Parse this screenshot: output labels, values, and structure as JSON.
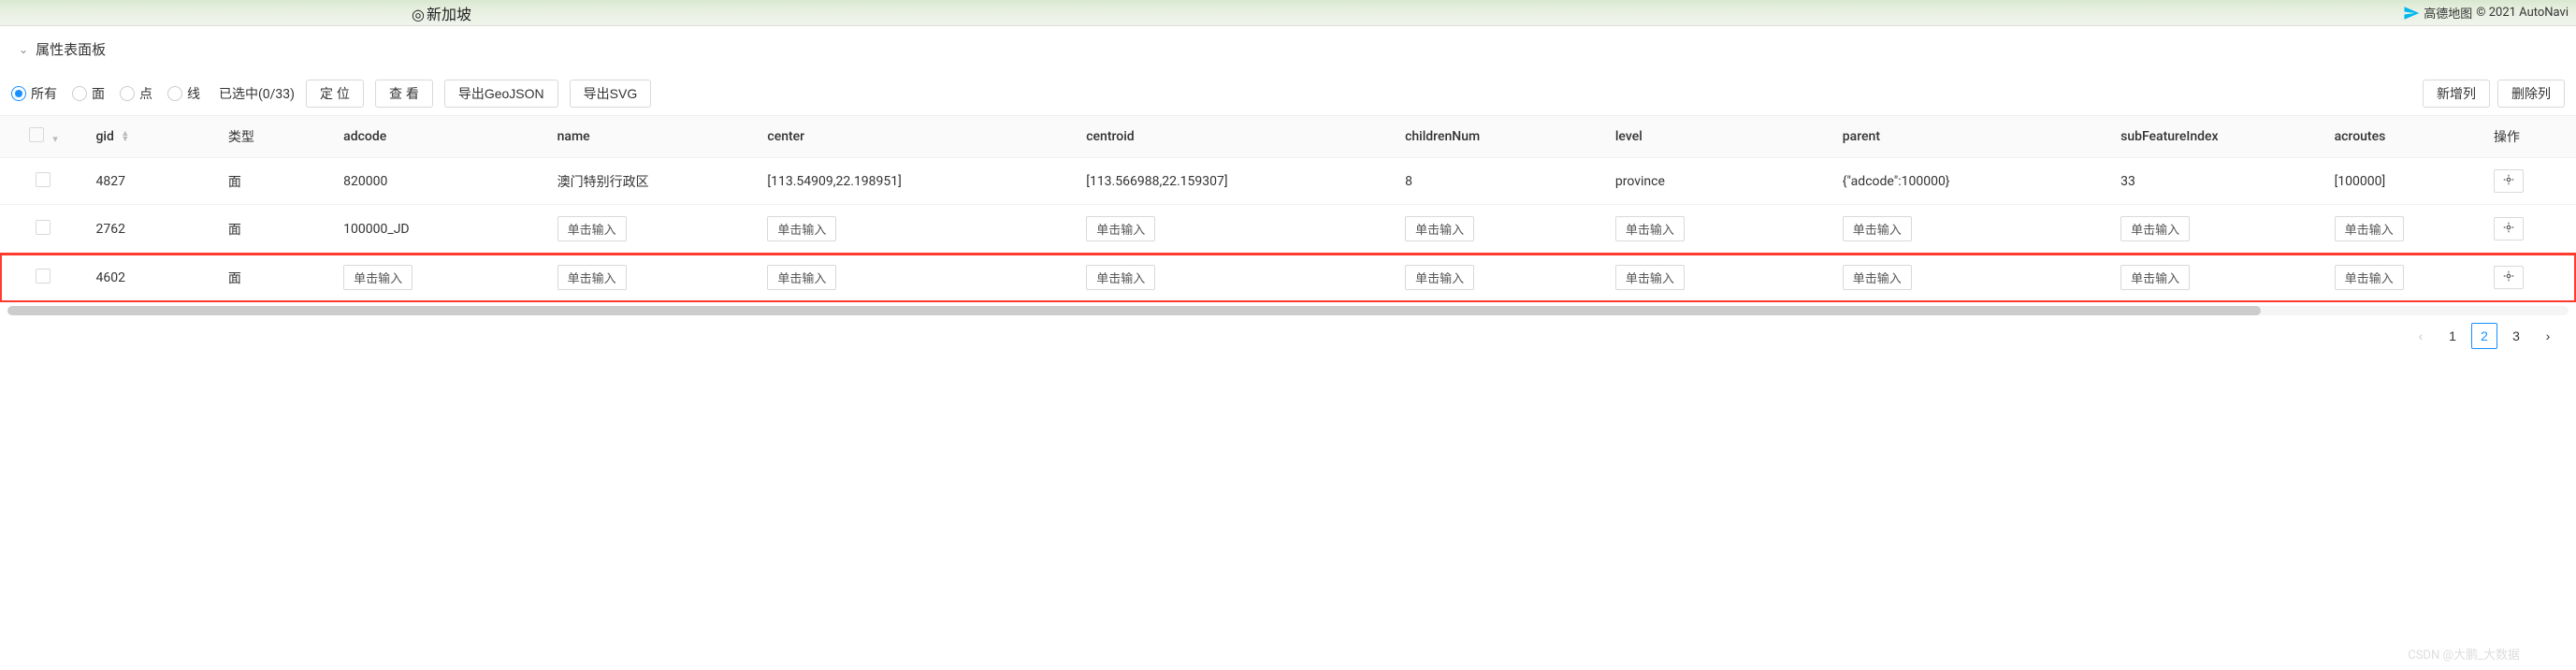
{
  "map": {
    "city_label": "新加坡",
    "brand": "高德地图",
    "copyright": "© 2021 AutoNavi"
  },
  "panel": {
    "title": "属性表面板"
  },
  "toolbar": {
    "radios": {
      "all": "所有",
      "polygon": "面",
      "point": "点",
      "line": "线"
    },
    "selection": "已选中(0/33)",
    "locate": "定 位",
    "view": "查 看",
    "export_geojson": "导出GeoJSON",
    "export_svg": "导出SVG",
    "add_column": "新增列",
    "delete_column": "删除列"
  },
  "table": {
    "headers": {
      "gid": "gid",
      "type": "类型",
      "adcode": "adcode",
      "name": "name",
      "center": "center",
      "centroid": "centroid",
      "childrenNum": "childrenNum",
      "level": "level",
      "parent": "parent",
      "subFeatureIndex": "subFeatureIndex",
      "acroutes": "acroutes",
      "action": "操作"
    },
    "placeholder": "单击输入",
    "rows": [
      {
        "gid": "4827",
        "type": "面",
        "adcode": "820000",
        "name": "澳门特别行政区",
        "center": "[113.54909,22.198951]",
        "centroid": "[113.566988,22.159307]",
        "childrenNum": "8",
        "level": "province",
        "parent": "{\"adcode\":100000}",
        "subFeatureIndex": "33",
        "acroutes": "[100000]"
      },
      {
        "gid": "2762",
        "type": "面",
        "adcode": "100000_JD",
        "name": "",
        "center": "",
        "centroid": "",
        "childrenNum": "",
        "level": "",
        "parent": "",
        "subFeatureIndex": "",
        "acroutes": ""
      },
      {
        "gid": "4602",
        "type": "面",
        "adcode": "",
        "name": "",
        "center": "",
        "centroid": "",
        "childrenNum": "",
        "level": "",
        "parent": "",
        "subFeatureIndex": "",
        "acroutes": ""
      }
    ]
  },
  "pagination": {
    "pages": [
      "1",
      "2",
      "3"
    ],
    "active": "2"
  },
  "watermark": "CSDN @大鹏_大数据"
}
